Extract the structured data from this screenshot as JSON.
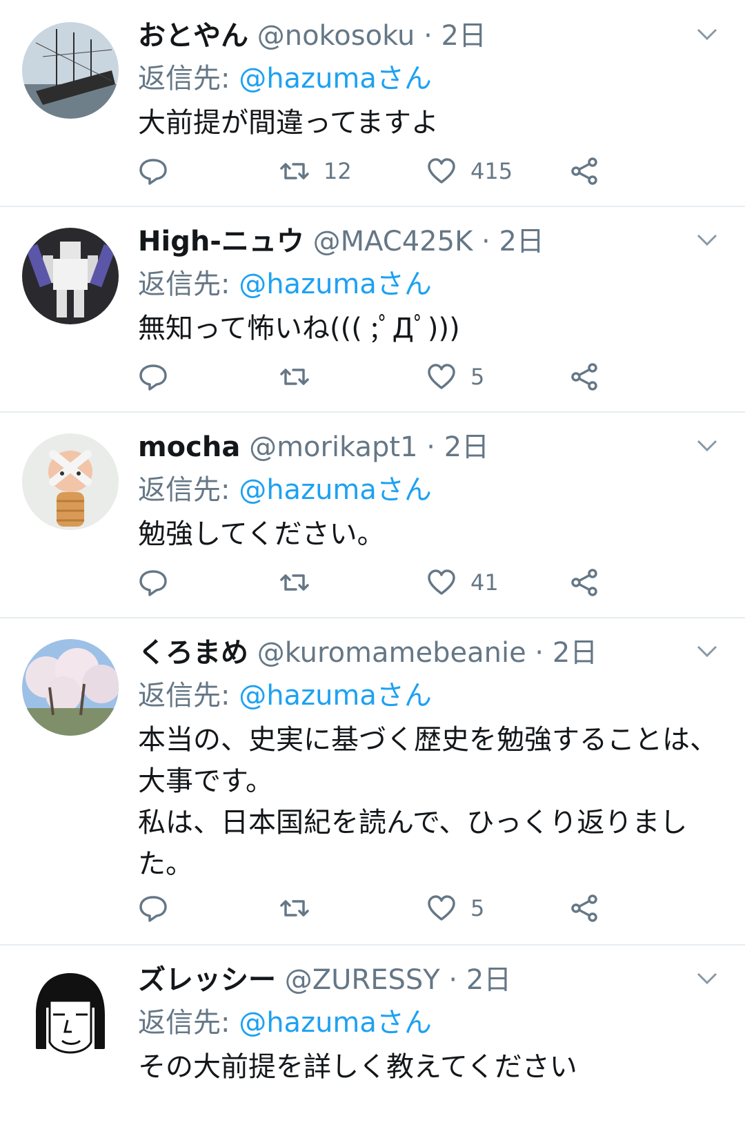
{
  "tweets": [
    {
      "name": "おとやん",
      "handle": "@nokosoku",
      "time": "2日",
      "reply_prefix": "返信先:",
      "reply_to": "@hazumaさん",
      "text": "大前提が間違ってますよ",
      "replies": "",
      "retweets": "12",
      "likes": "415",
      "avatar": "ship-photo"
    },
    {
      "name": "High-ニュウ",
      "handle": "@MAC425K",
      "time": "2日",
      "reply_prefix": "返信先:",
      "reply_to": "@hazumaさん",
      "text": "無知って怖いね((( ;ﾟДﾟ)))",
      "replies": "",
      "retweets": "",
      "likes": "5",
      "avatar": "robot-model-photo"
    },
    {
      "name": "mocha",
      "handle": "@morikapt1",
      "time": "2日",
      "reply_prefix": "返信先:",
      "reply_to": "@hazumaさん",
      "text": "勉強してください。",
      "replies": "",
      "retweets": "",
      "likes": "41",
      "avatar": "doll-figure"
    },
    {
      "name": "くろまめ",
      "handle": "@kuromamebeanie",
      "time": "2日",
      "reply_prefix": "返信先:",
      "reply_to": "@hazumaさん",
      "text": "本当の、史実に基づく歴史を勉強することは、大事です。\n私は、日本国紀を読んで、ひっくり返りました。",
      "replies": "",
      "retweets": "",
      "likes": "5",
      "avatar": "cherry-blossom-photo"
    },
    {
      "name": "ズレッシー",
      "handle": "@ZURESSY",
      "time": "2日",
      "reply_prefix": "返信先:",
      "reply_to": "@hazumaさん",
      "text": "その大前提を詳しく教えてください",
      "replies": "",
      "retweets": "",
      "likes": "",
      "avatar": "drawn-face"
    }
  ],
  "colors": {
    "accent": "#1da1f2",
    "muted": "#657786",
    "divider": "#e6ecf0",
    "text": "#14171a"
  }
}
